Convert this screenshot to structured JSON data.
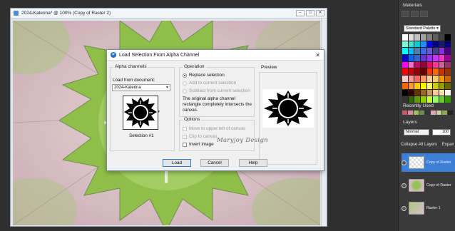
{
  "document": {
    "title": "2024-Katerina* @ 100% (Copy of Raster 2)"
  },
  "dialog": {
    "title": "Load Selection From Alpha Channel",
    "close_glyph": "✕",
    "alpha_group_label": "Alpha channels",
    "load_from_label": "Load from document:",
    "document_value": "2024-Katerina",
    "selection_caption": "Selection #1",
    "operation_label": "Operation",
    "replace_label": "Replace selection",
    "add_label": "Add to current selection",
    "subtract_label": "Subtract from current selection",
    "info_text": "The original alpha channel rectangle completely intersects the canvas.",
    "options_label": "Options",
    "move_label": "Move to upper left of canvas",
    "clip_label": "Clip to canvas",
    "invert_label": "Invert image",
    "preview_label": "Preview",
    "load_btn": "Load",
    "cancel_btn": "Cancel",
    "help_btn": "Help"
  },
  "watermark": "Maryjoy Design",
  "panels": {
    "materials_title": "Materials",
    "palette_select": "Standard Palette",
    "recently_used_label": "Recently Used",
    "layers_title": "Layers",
    "blend_mode": "Normal",
    "opacity": "100",
    "collapse_label": "Collapse All Layers",
    "expand_label": "Expan",
    "layers": [
      "Copy of Raster",
      "Copy of Raster",
      "Raster 1"
    ]
  },
  "colors": {
    "accent": "#3d7fd6",
    "canvas_pink": "#d9bfc7",
    "canvas_green": "#9bc25a"
  }
}
